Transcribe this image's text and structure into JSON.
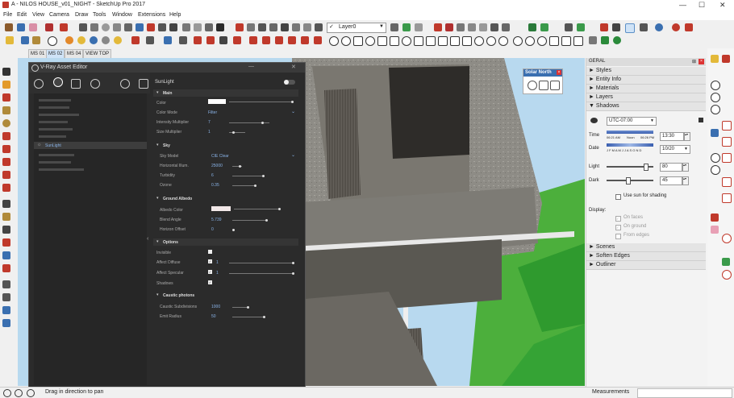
{
  "window": {
    "title": "A - NILOS HOUSE_v01_NIGHT - SketchUp Pro 2017"
  },
  "menu": [
    "File",
    "Edit",
    "View",
    "Camera",
    "Draw",
    "Tools",
    "Window",
    "Extensions",
    "Help"
  ],
  "toolbar": {
    "layer_value": "Layer0"
  },
  "scene_tabs": [
    "MS 01",
    "MS 02",
    "MS 04",
    "VIEW TOP"
  ],
  "solar_north": {
    "title": "Solar North"
  },
  "vray": {
    "title": "V-Ray Asset Editor",
    "selected_light": "SunLight",
    "list": [
      "SunLight"
    ],
    "sections": {
      "main": "Main",
      "sky": "Sky",
      "ground": "Ground Albedo",
      "options": "Options",
      "caustic": "Caustic photons"
    },
    "params": {
      "color": "Color",
      "color_mode": "Color Mode",
      "color_mode_val": "Filter",
      "intensity": "Intensity Multiplier",
      "intensity_val": "7",
      "size": "Size Multiplier",
      "size_val": "1",
      "sky_model": "Sky Model",
      "sky_model_val": "CIE Clear",
      "horiz": "Horizontal Illum.",
      "horiz_val": "25000",
      "turbidity": "Turbidity",
      "turbidity_val": "6",
      "ozone": "Ozone",
      "ozone_val": "0.35",
      "albedo_color": "Albedo Color",
      "blend": "Blend Angle",
      "blend_val": "5.739",
      "horizon": "Horizon Offset",
      "horizon_val": "0",
      "invisible": "Invisible",
      "affect_diffuse": "Affect Diffuse",
      "affect_diffuse_val": "1",
      "affect_specular": "Affect Specular",
      "affect_specular_val": "1",
      "shadows": "Shadows",
      "caustic_sub": "Caustic Subdivisions",
      "caustic_sub_val": "1000",
      "emit_radius": "Emit Radius",
      "emit_radius_val": "50"
    }
  },
  "tray": {
    "title": "GERAL",
    "items_top": [
      "Styles",
      "Entity Info",
      "Materials",
      "Layers",
      "Shadows"
    ],
    "timezone": "UTC-07:00",
    "time_label": "Time",
    "time_value": "13:30",
    "time_ticks": [
      "06:21 AM",
      "Noon",
      "06:26 PM"
    ],
    "date_label": "Date",
    "date_months": "J F M A M J J A S O N D",
    "date_value": "10/20",
    "light_label": "Light",
    "light_value": "80",
    "dark_label": "Dark",
    "dark_value": "45",
    "use_sun": "Use sun for shading",
    "display_label": "Display:",
    "on_faces": "On faces",
    "on_ground": "On ground",
    "from_edges": "From edges",
    "items_bottom": [
      "Scenes",
      "Soften Edges",
      "Outliner"
    ]
  },
  "status": {
    "text": "Drag in direction to pan",
    "measurements": "Measurements"
  }
}
